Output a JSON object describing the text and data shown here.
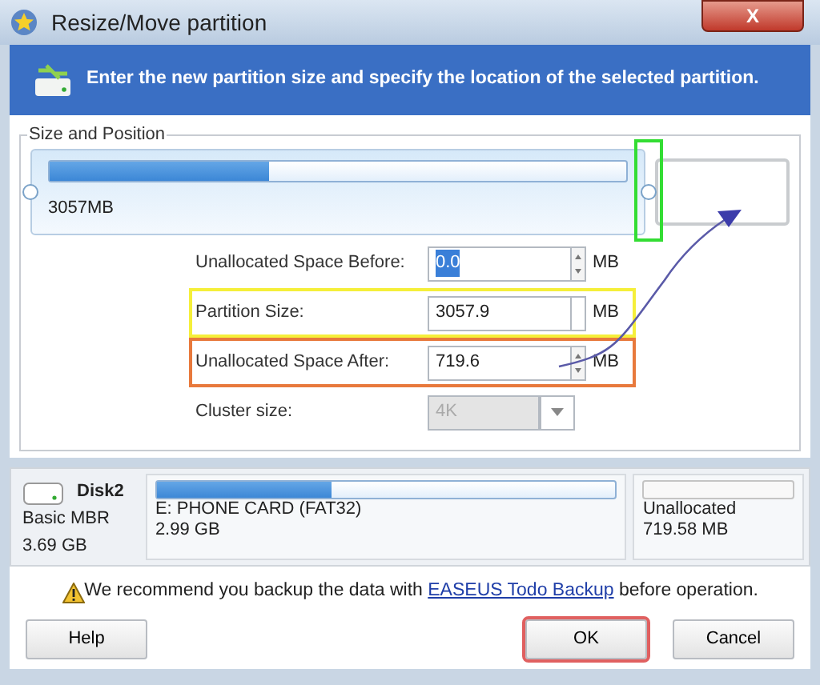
{
  "window": {
    "title": "Resize/Move partition",
    "close": "X"
  },
  "banner": {
    "text": "Enter the new partition size and specify the location of the selected partition."
  },
  "size_and_position": {
    "title": "Size and Position",
    "slider": {
      "level": 0.81,
      "label": "3057MB",
      "used": {
        "level": 0.38
      },
      "highlight": {
        "color": "#33dd33"
      }
    },
    "fields": [
      {
        "kind": "spin",
        "label": "Unallocated Space Before:",
        "value": "0.0",
        "unit": "MB",
        "selected": true
      },
      {
        "kind": "text",
        "label": "Partition Size:",
        "value": "3057.9",
        "unit": "MB",
        "selected": false,
        "color": "#f5ef3a"
      },
      {
        "kind": "spin",
        "label": "Unallocated Space After:",
        "value": "719.6",
        "unit": "MB",
        "selected": false,
        "color": "#e8793c"
      },
      {
        "kind": "select",
        "label": "Cluster size:",
        "value": "4K",
        "disabled": true,
        "selected": false
      }
    ]
  },
  "disk": {
    "name": "Disk2",
    "type": "Basic MBR",
    "size": "3.69 GB",
    "partitions": [
      {
        "kind": "partition",
        "name": "E: PHONE CARD (FAT32)",
        "size": "2.99 GB",
        "level": 0.38
      },
      {
        "kind": "unallocated",
        "name": "Unallocated",
        "size": "719.58 MB"
      }
    ]
  },
  "warning": {
    "before": "We recommend you backup the data with",
    "link": "EASEUS Todo Backup",
    "after": "before operation."
  },
  "buttons": [
    {
      "label": "Help",
      "highlight": false
    },
    {
      "label": "OK",
      "highlight": true
    },
    {
      "label": "Cancel",
      "highlight": false
    }
  ]
}
